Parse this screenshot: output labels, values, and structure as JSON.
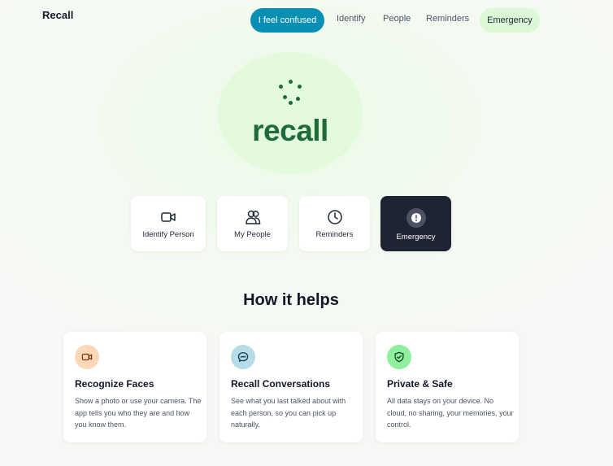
{
  "header": {
    "brand": "Recall",
    "nav": {
      "confused": "I feel confused",
      "identify": "Identify",
      "people": "People",
      "reminders": "Reminders",
      "emergency": "Emergency"
    }
  },
  "hero": {
    "wordmark": "recall"
  },
  "quick_actions": [
    {
      "label": "Identify Person",
      "icon": "video-camera-icon"
    },
    {
      "label": "My People",
      "icon": "people-icon"
    },
    {
      "label": "Reminders",
      "icon": "clock-icon"
    },
    {
      "label": "Emergency",
      "icon": "alert-icon"
    }
  ],
  "section": {
    "title": "How it helps"
  },
  "features": [
    {
      "title": "Recognize Faces",
      "body": "Show a photo or use your camera. The app tells you who they are and how you know them.",
      "icon": "video-camera-icon",
      "icon_bg": "#fcd8b8"
    },
    {
      "title": "Recall Conversations",
      "body": "See what you last talked about with each person, so you can pick up naturally.",
      "icon": "chat-bubble-icon",
      "icon_bg": "#b6dce7"
    },
    {
      "title": "Private & Safe",
      "body": "All data stays on your device. No cloud, no sharing, your memories, your control.",
      "icon": "shield-check-icon",
      "icon_bg": "#8ef09c"
    }
  ],
  "colors": {
    "primary": "#0a8fb4",
    "brand_green": "#1e6b3a",
    "emergency_pill": "#dcf8d6",
    "emergency_card": "#1e2433"
  }
}
